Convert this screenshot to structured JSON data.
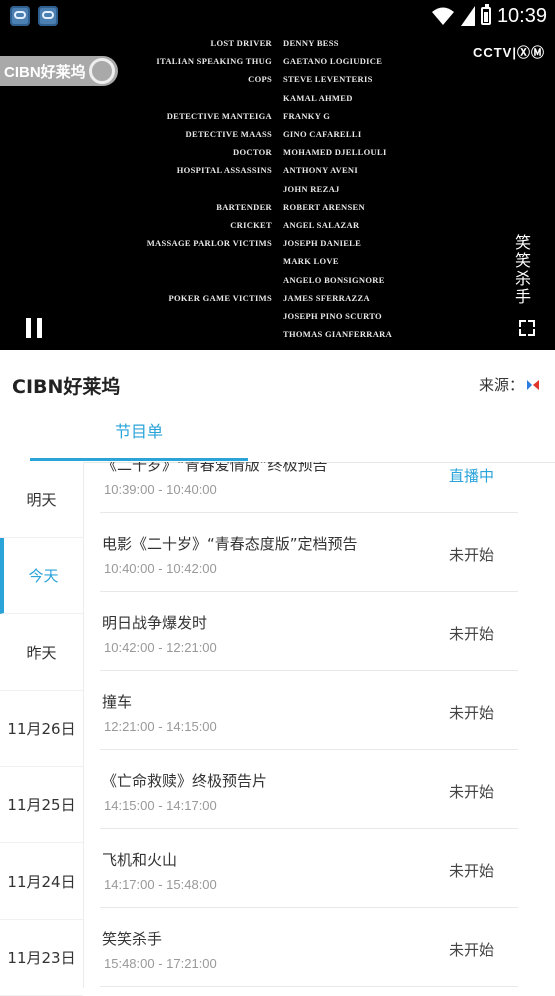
{
  "status_bar": {
    "time": "10:39",
    "icons": [
      "app-icon",
      "app-icon",
      "wifi-icon",
      "signal-icon",
      "battery-icon"
    ]
  },
  "video": {
    "channel_logo_text": "CIBN好莱坞",
    "broadcaster_logo_text": "CCTV|ⓍⓂ",
    "vertical_title": "笑笑杀手",
    "credits": [
      {
        "role": "LOST DRIVER",
        "actor": "DENNY BESS"
      },
      {
        "role": "ITALIAN SPEAKING THUG",
        "actor": "GAETANO LOGIUDICE"
      },
      {
        "role": "COPS",
        "actor": "STEVE LEVENTERIS"
      },
      {
        "role": "",
        "actor": "KAMAL AHMED"
      },
      {
        "role": "DETECTIVE MANTEIGA",
        "actor": "FRANKY G"
      },
      {
        "role": "DETECTIVE MAASS",
        "actor": "GINO CAFARELLI"
      },
      {
        "role": "DOCTOR",
        "actor": "MOHAMED DJELLOULI"
      },
      {
        "role": "HOSPITAL ASSASSINS",
        "actor": "ANTHONY AVENI"
      },
      {
        "role": "",
        "actor": "JOHN REZAJ"
      },
      {
        "role": "BARTENDER",
        "actor": "ROBERT ARENSEN"
      },
      {
        "role": "CRICKET",
        "actor": "ANGEL SALAZAR"
      },
      {
        "role": "MASSAGE PARLOR VICTIMS",
        "actor": "JOSEPH DANIELE"
      },
      {
        "role": "",
        "actor": "MARK LOVE"
      },
      {
        "role": "",
        "actor": "ANGELO BONSIGNORE"
      },
      {
        "role": "POKER GAME VICTIMS",
        "actor": "JAMES SFERRAZZA"
      },
      {
        "role": "",
        "actor": "JOSEPH PINO SCURTO"
      },
      {
        "role": "",
        "actor": "THOMAS GIANFERRARA"
      }
    ]
  },
  "channel": {
    "title": "CIBN好莱坞",
    "source_label": "来源："
  },
  "tabs": [
    {
      "label": "节目单",
      "active": true
    }
  ],
  "days": [
    {
      "label": "明天",
      "active": false
    },
    {
      "label": "今天",
      "active": true
    },
    {
      "label": "昨天",
      "active": false
    },
    {
      "label": "11月26日",
      "active": false
    },
    {
      "label": "11月25日",
      "active": false
    },
    {
      "label": "11月24日",
      "active": false
    },
    {
      "label": "11月23日",
      "active": false
    }
  ],
  "programs": [
    {
      "title": "《二十岁》“青春爱情版”终极预告",
      "time": "10:39:00 - 10:40:00",
      "status": "直播中",
      "live": true
    },
    {
      "title": "电影《二十岁》“青春态度版”定档预告",
      "time": "10:40:00 - 10:42:00",
      "status": "未开始",
      "live": false
    },
    {
      "title": "明日战争爆发时",
      "time": "10:42:00 - 12:21:00",
      "status": "未开始",
      "live": false
    },
    {
      "title": "撞车",
      "time": "12:21:00 - 14:15:00",
      "status": "未开始",
      "live": false
    },
    {
      "title": "《亡命救赎》终极预告片",
      "time": "14:15:00 - 14:17:00",
      "status": "未开始",
      "live": false
    },
    {
      "title": "飞机和火山",
      "time": "14:17:00 - 15:48:00",
      "status": "未开始",
      "live": false
    },
    {
      "title": "笑笑杀手",
      "time": "15:48:00 - 17:21:00",
      "status": "未开始",
      "live": false
    }
  ],
  "colors": {
    "accent": "#2aa3d9",
    "video_bg": "#000000"
  }
}
